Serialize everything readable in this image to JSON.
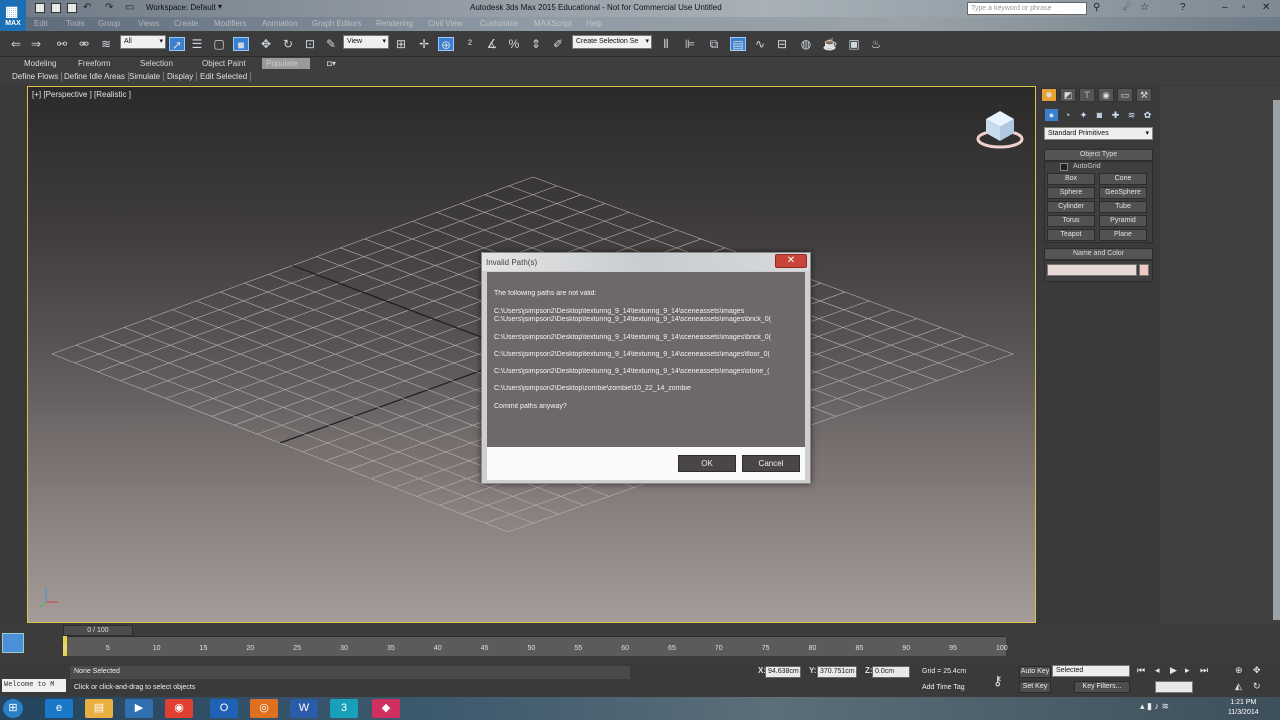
{
  "titlebar": {
    "app_logo": "MAX",
    "workspace": "Workspace: Default",
    "window_title": "Autodesk 3ds Max 2015 Educational - Not for Commercial Use   Untitled",
    "search_placeholder": "Type a keyword or phrase"
  },
  "menubar": {
    "items": [
      "Edit",
      "Tools",
      "Group",
      "Views",
      "Create",
      "Modifiers",
      "Animation",
      "Graph Editors",
      "Rendering",
      "Civil View",
      "Customize",
      "MAXScript",
      "Help"
    ]
  },
  "toolbar": {
    "filter_value": "All",
    "refcoord_value": "View",
    "named_selection_value": "Create Selection Se"
  },
  "ribbon": {
    "tabs": [
      "Modeling",
      "Freeform",
      "Selection",
      "Object Paint",
      "Populate"
    ],
    "sub_items": [
      "Define Flows",
      "Define Idle Areas",
      "Simulate",
      "Display",
      "Edit Selected"
    ]
  },
  "viewport": {
    "label": "[+] [Perspective ] [Realistic ]"
  },
  "dialog": {
    "title": "Invalid Path(s)",
    "close_glyph": "✕",
    "intro": "The following paths are not valid:",
    "paths": [
      "C:\\Users\\jsimpson2\\Desktop\\texturing_9_14\\texturing_9_14\\sceneassets\\images",
      "C:\\Users\\jsimpson2\\Desktop\\texturing_9_14\\texturing_9_14\\sceneassets\\images\\brick_0(",
      "C:\\Users\\jsimpson2\\Desktop\\texturing_9_14\\texturing_9_14\\sceneassets\\images\\brick_0(",
      "C:\\Users\\jsimpson2\\Desktop\\texturing_9_14\\texturing_9_14\\sceneassets\\images\\floor_0(",
      "C:\\Users\\jsimpson2\\Desktop\\texturing_9_14\\texturing_9_14\\sceneassets\\images\\stone_(",
      "C:\\Users\\jsimpson2\\Desktop\\zombie\\zombie\\10_22_14_zombie"
    ],
    "question": "Commit paths anyway?",
    "ok_label": "OK",
    "cancel_label": "Cancel"
  },
  "command_panel": {
    "category_value": "Standard Primitives",
    "object_type_title": "Object Type",
    "autogrid_label": "AutoGrid",
    "object_buttons": [
      "Box",
      "Cone",
      "Sphere",
      "GeoSphere",
      "Cylinder",
      "Tube",
      "Torus",
      "Pyramid",
      "Teapot",
      "Plane"
    ],
    "name_color_title": "Name and Color"
  },
  "timeline": {
    "slider_label": "0 / 100",
    "ticks": [
      "0",
      "5",
      "10",
      "15",
      "20",
      "25",
      "30",
      "35",
      "40",
      "45",
      "50",
      "55",
      "60",
      "65",
      "70",
      "75",
      "80",
      "85",
      "90",
      "95",
      "100"
    ]
  },
  "status": {
    "script_listener": "Welcome to M",
    "selection": "None Selected",
    "prompt": "Click or click-and-drag to select objects",
    "x_label": "X:",
    "x_value": "94.638cm",
    "y_label": "Y:",
    "y_value": "370.751cm",
    "z_label": "Z:",
    "z_value": "0.0cm",
    "grid": "Grid = 25.4cm",
    "add_time_tag": "Add Time Tag",
    "auto_key": "Auto Key",
    "set_key": "Set Key",
    "selected_value": "Selected",
    "key_filters": "Key Filters..."
  },
  "taskbar": {
    "clock_time": "1:21 PM",
    "clock_date": "11/3/2014"
  },
  "colors": {
    "viewport_border": "#e0c24a",
    "active_blue": "#3a7fd0",
    "close_red": "#c9453a"
  }
}
